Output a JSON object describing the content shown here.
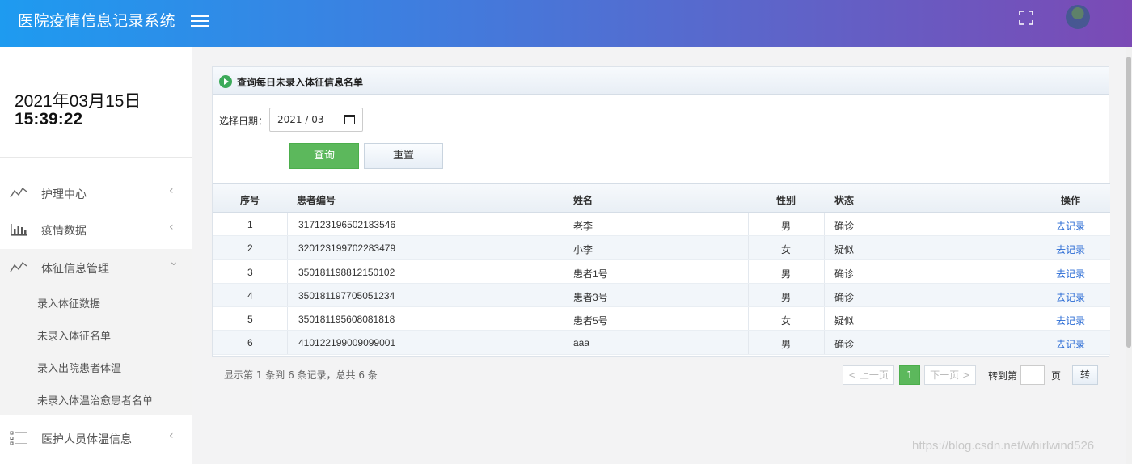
{
  "header": {
    "title": "医院疫情信息记录系统",
    "menu_icon": "hamburger-icon",
    "fullscreen_icon": "fullscreen-icon",
    "avatar_icon": "user-avatar-icon"
  },
  "sidebar": {
    "date": "2021年03月15日",
    "time": "15:39:22",
    "items": [
      {
        "label": "护理中心",
        "icon": "line-chart-icon",
        "arrow": "‹"
      },
      {
        "label": "疫情数据",
        "icon": "bar-chart-icon",
        "arrow": "‹"
      },
      {
        "label": "体征信息管理",
        "icon": "line-chart-icon",
        "arrow": "⌄"
      },
      {
        "label": "医护人员体温信息",
        "icon": "list-icon",
        "arrow": "‹"
      }
    ],
    "sub_items": [
      "录入体征数据",
      "未录入体征名单",
      "录入出院患者体温",
      "未录入体温治愈患者名单"
    ]
  },
  "panel": {
    "title": "查询每日未录入体征信息名单",
    "date_label": "选择日期：",
    "date_value": "2021 / 03",
    "query_label": "查询",
    "reset_label": "重置"
  },
  "table": {
    "headers": [
      "序号",
      "患者编号",
      "姓名",
      "性别",
      "状态",
      "操作"
    ],
    "rows": [
      {
        "no": "1",
        "id": "317123196502183546",
        "name": "老李",
        "gender": "男",
        "status": "确诊",
        "action": "去记录"
      },
      {
        "no": "2",
        "id": "320123199702283479",
        "name": "小李",
        "gender": "女",
        "status": "疑似",
        "action": "去记录"
      },
      {
        "no": "3",
        "id": "350181198812150102",
        "name": "患者1号",
        "gender": "男",
        "status": "确诊",
        "action": "去记录"
      },
      {
        "no": "4",
        "id": "350181197705051234",
        "name": "患者3号",
        "gender": "男",
        "status": "确诊",
        "action": "去记录"
      },
      {
        "no": "5",
        "id": "350181195608081818",
        "name": "患者5号",
        "gender": "女",
        "status": "疑似",
        "action": "去记录"
      },
      {
        "no": "6",
        "id": "410122199009099001",
        "name": "aaa",
        "gender": "男",
        "status": "确诊",
        "action": "去记录"
      }
    ]
  },
  "pager": {
    "info": "显示第 1 条到 6 条记录，总共 6 条",
    "prev": "< 上一页",
    "current": "1",
    "next": "下一页 >",
    "goto_label": "转到第",
    "page_unit": "页",
    "go": "转"
  },
  "watermark": "https://blog.csdn.net/whirlwind526",
  "colors": {
    "accent_green": "#5cb85c",
    "link_blue": "#2a6bd4",
    "header_start": "#1e9bf0",
    "header_end": "#7b4ab5"
  }
}
